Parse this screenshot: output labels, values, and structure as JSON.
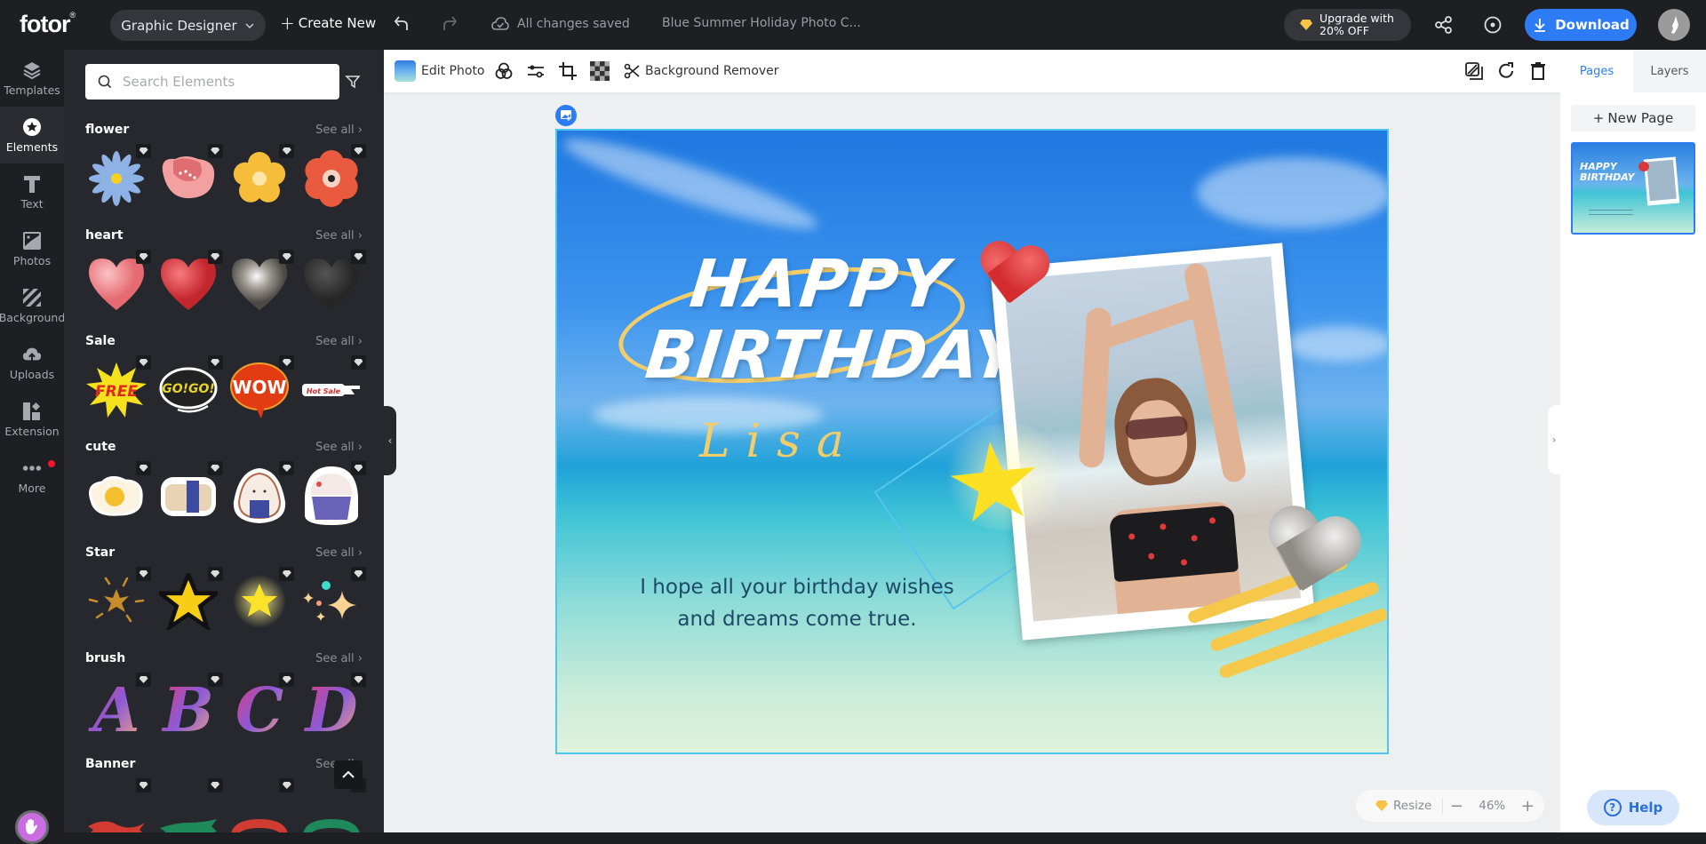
{
  "topbar": {
    "logo": "fotor",
    "logo_mark": "®",
    "team_label": "Graphic Designer",
    "create_new_label": "Create New",
    "save_status": "All changes saved",
    "document_title": "Blue Summer Holiday Photo C...",
    "upgrade_line1": "Upgrade with",
    "upgrade_line2": "20% OFF",
    "download_label": "Download"
  },
  "leftnav": {
    "items": [
      {
        "label": "Templates",
        "icon": "layers-icon"
      },
      {
        "label": "Elements",
        "icon": "star-circle-icon",
        "active": true
      },
      {
        "label": "Text",
        "icon": "text-t-icon"
      },
      {
        "label": "Photos",
        "icon": "image-icon"
      },
      {
        "label": "Background",
        "icon": "stripes-icon"
      },
      {
        "label": "Uploads",
        "icon": "cloud-upload-icon"
      },
      {
        "label": "Extension",
        "icon": "extension-icon"
      },
      {
        "label": "More",
        "icon": "more-dots-icon",
        "badge": true
      }
    ]
  },
  "panel": {
    "search_placeholder": "Search Elements",
    "see_all_label": "See all",
    "sections": [
      {
        "title": "flower",
        "items": [
          "blue daisy",
          "pink poppy",
          "yellow flower",
          "red flower"
        ]
      },
      {
        "title": "heart",
        "items": [
          "pink heart",
          "red heart",
          "silver heart",
          "black heart"
        ]
      },
      {
        "title": "Sale",
        "items": [
          "FREE",
          "GO!GO!",
          "WOW",
          "Hot Sale"
        ]
      },
      {
        "title": "cute",
        "items": [
          "fried egg",
          "sushi roll",
          "onigiri",
          "cupcake"
        ]
      },
      {
        "title": "Star",
        "items": [
          "sparkle burst",
          "pixel star",
          "glow star",
          "twinkles"
        ]
      },
      {
        "title": "brush",
        "items": [
          "A",
          "B",
          "C",
          "D"
        ]
      },
      {
        "title": "Banner",
        "items": [
          "red ribbon",
          "green ribbon",
          "red ribbon 2",
          "green ribbon 2"
        ]
      }
    ]
  },
  "toolbar": {
    "edit_photo_label": "Edit Photo",
    "background_remover_label": "Background Remover"
  },
  "canvas": {
    "title_line1": "HAPPY",
    "title_line2": "BIRTHDAY",
    "name": "Lisa",
    "message_line1": "I hope all your birthday wishes",
    "message_line2": "and dreams come true."
  },
  "zoom_bar": {
    "resize_label": "Resize",
    "zoom_level": "46%"
  },
  "rightpanel": {
    "tabs": [
      {
        "label": "Pages",
        "active": true
      },
      {
        "label": "Layers",
        "active": false
      }
    ],
    "new_page_label": "New Page",
    "thumb_title_1": "HAPPY",
    "thumb_title_2": "BIRTHDAY"
  },
  "help_label": "Help",
  "colors": {
    "accent": "#2d7cf6",
    "topbar_bg": "#1e1f23",
    "panel_bg": "#27282d",
    "selection": "#4ec5f2",
    "gold": "#f2cd6a"
  }
}
